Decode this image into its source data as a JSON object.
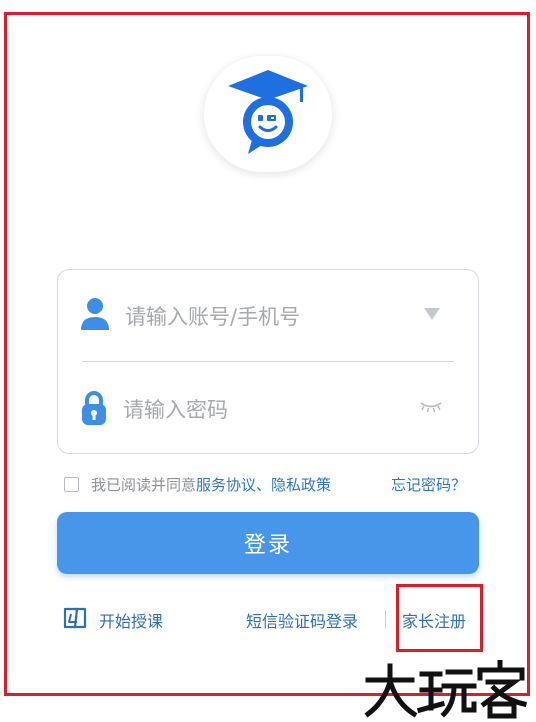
{
  "account": {
    "placeholder": "请输入账号/手机号",
    "icon": "user-icon",
    "dropdown_icon": "triangle-down-icon"
  },
  "password": {
    "placeholder": "请输入密码",
    "icon": "lock-icon",
    "toggle_icon": "eye-closed-icon"
  },
  "agreement": {
    "prefix": "我已阅读并同意",
    "terms": "服务协议",
    "separator": "、",
    "privacy": "隐私政策",
    "checked": false
  },
  "forgot_password": "忘记密码？",
  "login_button": "登录",
  "bottom": {
    "start_teaching": "开始授课",
    "sms_login": "短信验证码登录",
    "parent_register": "家长注册"
  },
  "watermark": "大玩客",
  "colors": {
    "primary": "#4796ea",
    "link": "#2f76c8",
    "annotation_red": "#d9202a",
    "logo_blue": "#1e6fe0"
  }
}
